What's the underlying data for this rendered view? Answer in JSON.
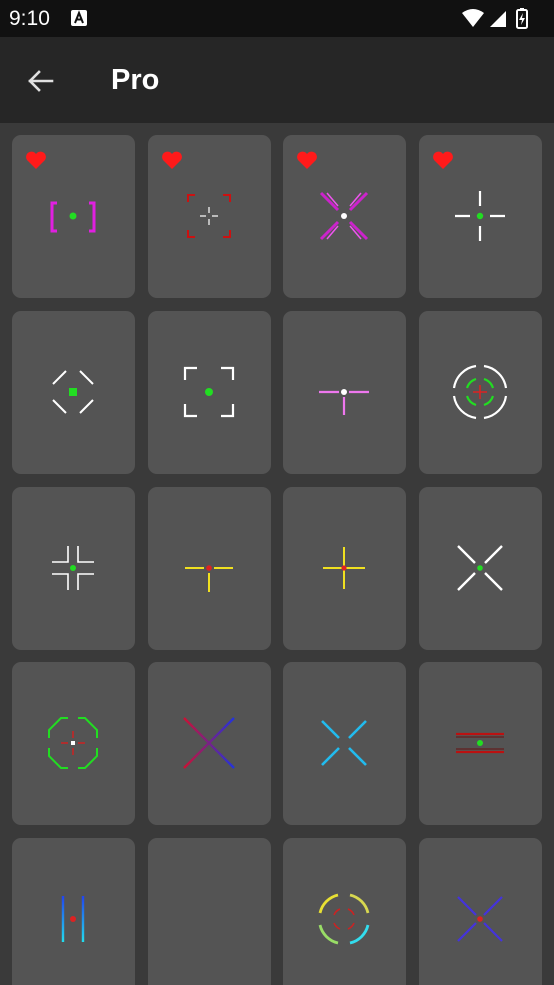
{
  "status": {
    "time": "9:10"
  },
  "header": {
    "title": "Pro"
  },
  "colors": {
    "heart": "#ff1a1a",
    "tile": "#545454",
    "background": "#3a3a3a",
    "appbar": "#262626"
  },
  "tiles": [
    {
      "icon": "crosshair-bracket-magenta",
      "favorite": true
    },
    {
      "icon": "crosshair-corners-red",
      "favorite": true
    },
    {
      "icon": "crosshair-x-magenta",
      "favorite": true
    },
    {
      "icon": "crosshair-plus-white",
      "favorite": true
    },
    {
      "icon": "crosshair-diagonal-white-green",
      "favorite": false
    },
    {
      "icon": "crosshair-square-corners-white",
      "favorite": false
    },
    {
      "icon": "crosshair-t-pink",
      "favorite": false
    },
    {
      "icon": "crosshair-circle-white-green",
      "favorite": false
    },
    {
      "icon": "crosshair-corner-ticks-white",
      "favorite": false
    },
    {
      "icon": "crosshair-t-yellow",
      "favorite": false
    },
    {
      "icon": "crosshair-plus-yellow",
      "favorite": false
    },
    {
      "icon": "crosshair-x-white",
      "favorite": false
    },
    {
      "icon": "crosshair-octagon-green",
      "favorite": false
    },
    {
      "icon": "crosshair-x-gradient-red-blue",
      "favorite": false
    },
    {
      "icon": "crosshair-x-cyan",
      "favorite": false
    },
    {
      "icon": "crosshair-lines-red",
      "favorite": false
    },
    {
      "icon": "crosshair-bars-blue-cyan",
      "favorite": false
    },
    {
      "icon": "crosshair-plus-blue-cyan",
      "favorite": false
    },
    {
      "icon": "crosshair-circle-yellow-cyan",
      "favorite": false
    },
    {
      "icon": "crosshair-x-blue-purple",
      "favorite": false
    }
  ]
}
